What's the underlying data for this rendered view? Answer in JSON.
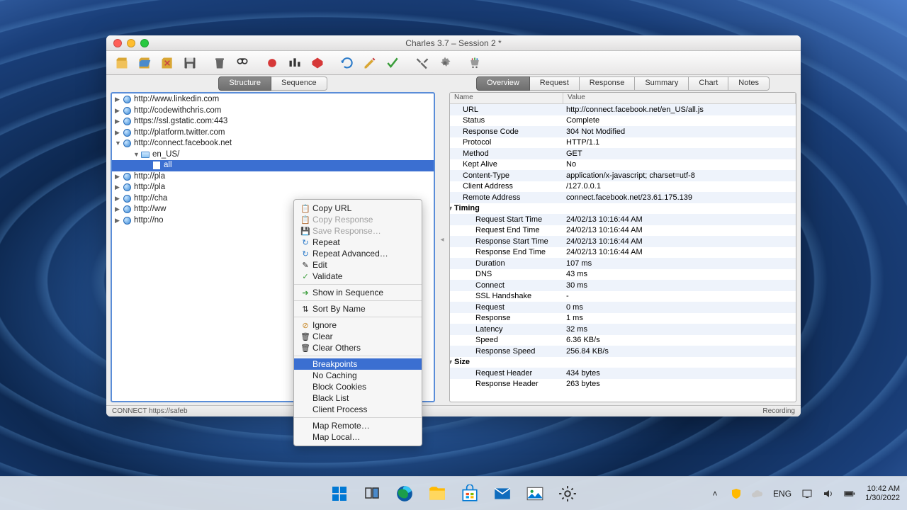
{
  "window": {
    "title": "Charles 3.7 – Session 2 *"
  },
  "left_tabs": {
    "structure": "Structure",
    "sequence": "Sequence"
  },
  "right_tabs": {
    "overview": "Overview",
    "request": "Request",
    "response": "Response",
    "summary": "Summary",
    "chart": "Chart",
    "notes": "Notes"
  },
  "tree": {
    "items": [
      {
        "label": "http://www.linkedin.com"
      },
      {
        "label": "http://codewithchris.com"
      },
      {
        "label": "https://ssl.gstatic.com:443"
      },
      {
        "label": "http://platform.twitter.com"
      },
      {
        "label": "http://connect.facebook.net"
      },
      {
        "label": "en_US/"
      },
      {
        "label": "all"
      },
      {
        "label": "http://pla"
      },
      {
        "label": "http://pla"
      },
      {
        "label": "http://cha"
      },
      {
        "label": "http://ww"
      },
      {
        "label": "http://no"
      }
    ]
  },
  "overview_header": {
    "name": "Name",
    "value": "Value"
  },
  "overview": [
    {
      "n": "URL",
      "v": "http://connect.facebook.net/en_US/all.js"
    },
    {
      "n": "Status",
      "v": "Complete"
    },
    {
      "n": "Response Code",
      "v": "304 Not Modified"
    },
    {
      "n": "Protocol",
      "v": "HTTP/1.1"
    },
    {
      "n": "Method",
      "v": "GET"
    },
    {
      "n": "Kept Alive",
      "v": "No"
    },
    {
      "n": "Content-Type",
      "v": "application/x-javascript; charset=utf-8"
    },
    {
      "n": "Client Address",
      "v": "/127.0.0.1"
    },
    {
      "n": "Remote Address",
      "v": "connect.facebook.net/23.61.175.139"
    }
  ],
  "timing_label": "Timing",
  "timing": [
    {
      "n": "Request Start Time",
      "v": "24/02/13 10:16:44 AM"
    },
    {
      "n": "Request End Time",
      "v": "24/02/13 10:16:44 AM"
    },
    {
      "n": "Response Start Time",
      "v": "24/02/13 10:16:44 AM"
    },
    {
      "n": "Response End Time",
      "v": "24/02/13 10:16:44 AM"
    },
    {
      "n": "Duration",
      "v": "107 ms"
    },
    {
      "n": "DNS",
      "v": "43 ms"
    },
    {
      "n": "Connect",
      "v": "30 ms"
    },
    {
      "n": "SSL Handshake",
      "v": "-"
    },
    {
      "n": "Request",
      "v": "0 ms"
    },
    {
      "n": "Response",
      "v": "1 ms"
    },
    {
      "n": "Latency",
      "v": "32 ms"
    },
    {
      "n": "Speed",
      "v": "6.36 KB/s"
    },
    {
      "n": "Response Speed",
      "v": "256.84 KB/s"
    }
  ],
  "size_label": "Size",
  "size": [
    {
      "n": "Request Header",
      "v": "434 bytes"
    },
    {
      "n": "Response Header",
      "v": "263 bytes"
    }
  ],
  "context_menu": {
    "copy_url": "Copy URL",
    "copy_response": "Copy Response",
    "save_response": "Save Response…",
    "repeat": "Repeat",
    "repeat_advanced": "Repeat Advanced…",
    "edit": "Edit",
    "validate": "Validate",
    "show_in_sequence": "Show in Sequence",
    "sort_by_name": "Sort By Name",
    "ignore": "Ignore",
    "clear": "Clear",
    "clear_others": "Clear Others",
    "breakpoints": "Breakpoints",
    "no_caching": "No Caching",
    "block_cookies": "Block Cookies",
    "black_list": "Black List",
    "client_process": "Client Process",
    "map_remote": "Map Remote…",
    "map_local": "Map Local…"
  },
  "statusbar": {
    "left": "CONNECT https://safeb",
    "right": "Recording"
  },
  "taskbar": {
    "lang": "ENG",
    "time": "10:42 AM",
    "date": "1/30/2022"
  }
}
